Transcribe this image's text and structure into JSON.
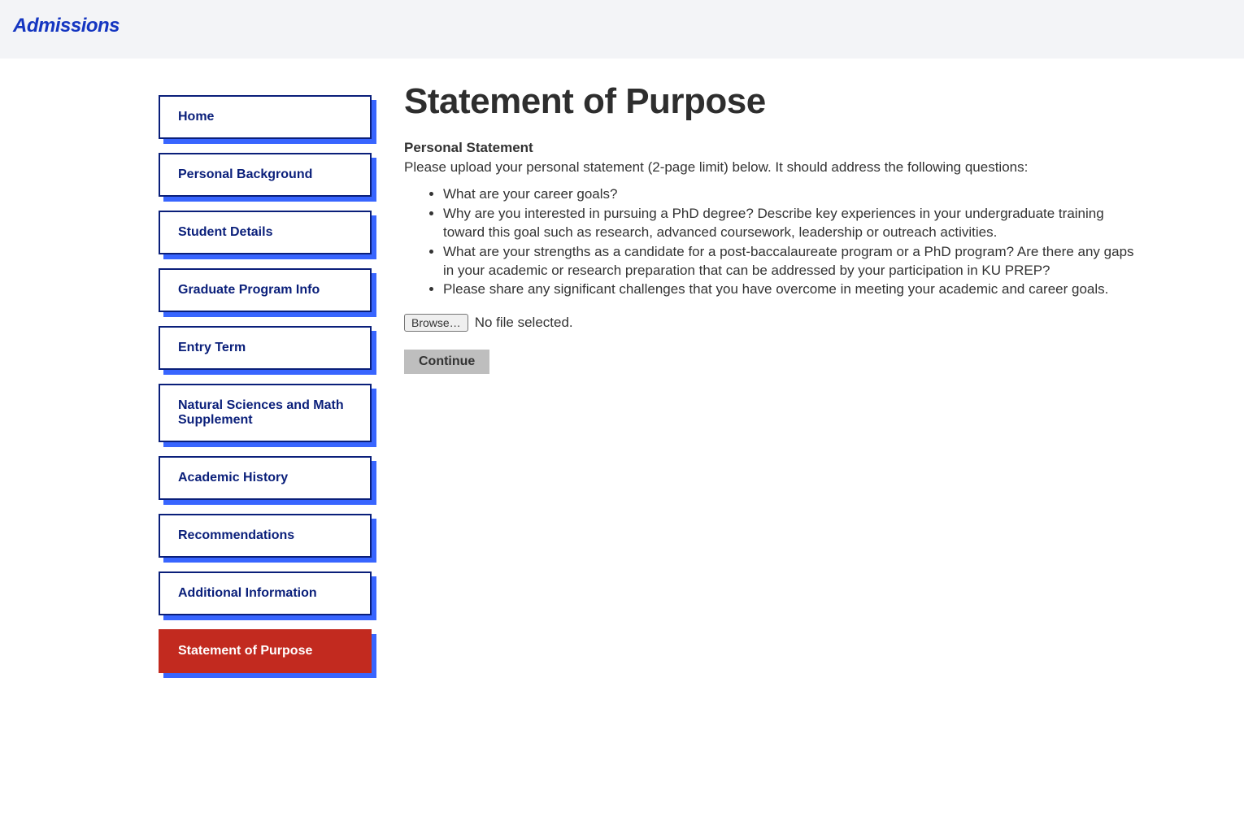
{
  "header": {
    "title": "Admissions"
  },
  "sidebar": {
    "items": [
      {
        "label": "Home",
        "active": false
      },
      {
        "label": "Personal Background",
        "active": false
      },
      {
        "label": "Student Details",
        "active": false
      },
      {
        "label": "Graduate Program Info",
        "active": false
      },
      {
        "label": "Entry Term",
        "active": false
      },
      {
        "label": "Natural Sciences and Math Supplement",
        "active": false
      },
      {
        "label": "Academic History",
        "active": false
      },
      {
        "label": "Recommendations",
        "active": false
      },
      {
        "label": "Additional Information",
        "active": false
      },
      {
        "label": "Statement of Purpose",
        "active": true
      }
    ]
  },
  "main": {
    "title": "Statement of Purpose",
    "section_heading": "Personal Statement",
    "intro_text": "Please upload your personal statement (2-page limit) below. It should address the following questions:",
    "bullets": [
      "What are your career goals?",
      "Why are you interested in pursuing a PhD degree? Describe key experiences in your undergraduate training toward this goal such as research, advanced coursework, leadership or outreach activities.",
      "What are your strengths as a candidate for a post-baccalaureate program or a PhD program? Are there any gaps in your academic or research preparation that can be addressed by your participation in KU PREP?",
      "Please share any significant challenges that you have overcome in meeting your academic and career goals."
    ],
    "browse_label": "Browse…",
    "file_status": "No file selected.",
    "continue_label": "Continue"
  }
}
